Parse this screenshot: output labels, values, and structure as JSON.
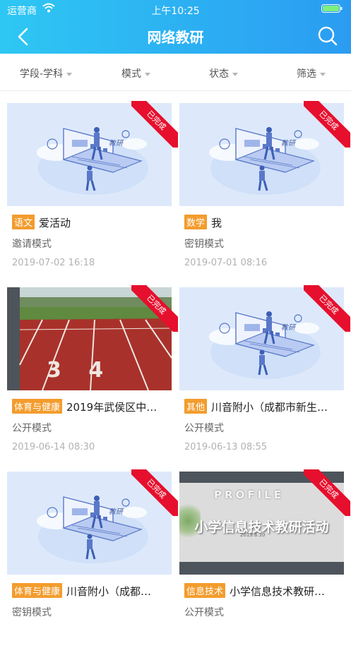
{
  "status_bar": {
    "carrier": "运营商",
    "time": "上午10:25"
  },
  "nav": {
    "title": "网络教研"
  },
  "filters": [
    "学段-学科",
    "模式",
    "状态",
    "筛选"
  ],
  "badge_text": "已完成",
  "illustration_caption": "教研",
  "cards": [
    {
      "subject": "语文",
      "title": "爱活动",
      "mode": "邀请模式",
      "date": "2019-07-02 16:18",
      "thumbnail": "illustration"
    },
    {
      "subject": "数学",
      "title": "我",
      "mode": "密钥模式",
      "date": "2019-07-01 08:16",
      "thumbnail": "illustration"
    },
    {
      "subject": "体育与健康",
      "title": "2019年武侯区中…",
      "mode": "公开模式",
      "date": "2019-06-14 08:30",
      "thumbnail": "running-track",
      "photo_text": "3 4"
    },
    {
      "subject": "其他",
      "title": "川音附小（成都市新生…",
      "mode": "公开模式",
      "date": "2019-06-13 08:55",
      "thumbnail": "illustration"
    },
    {
      "subject": "体育与健康",
      "title": "川音附小（成都…",
      "mode": "密钥模式",
      "date": "",
      "thumbnail": "illustration"
    },
    {
      "subject": "信息技术",
      "title": "小学信息技术教研…",
      "mode": "公开模式",
      "date": "",
      "thumbnail": "slide",
      "slide_heading": "PROFILE",
      "slide_title": "小学信息技术教研活动",
      "slide_date": "2019.6.10"
    }
  ],
  "colors": {
    "header_start": "#2ec7f3",
    "header_end": "#2b9cf2",
    "badge": "#e60f2d",
    "subject_tag": "#f39c2d"
  }
}
